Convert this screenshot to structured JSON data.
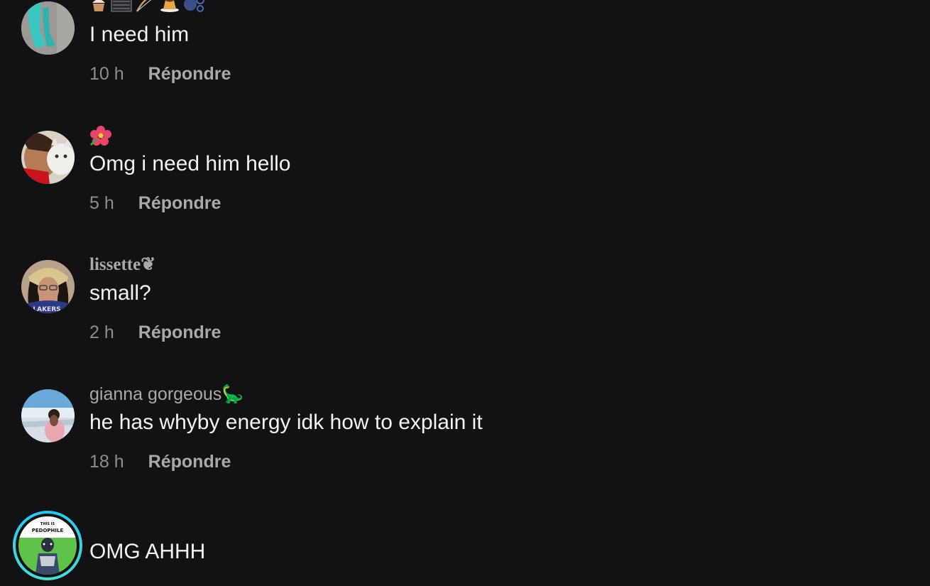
{
  "reply_label": "Répondre",
  "colors": {
    "background": "#121214",
    "text": "#f2f2f2",
    "muted": "#8d8d92",
    "reply": "#a9a9ad",
    "story_ring": "#29c4f0"
  },
  "comments": [
    {
      "username_icons": [
        "cupcake-icon",
        "music-sheet-icon",
        "bow-icon",
        "pudding-icon",
        "bubbles-icon"
      ],
      "text": "I need him",
      "time": "10 h"
    },
    {
      "username_icons": [
        "hibiscus-icon"
      ],
      "text": "Omg i need him hello",
      "time": "5 h"
    },
    {
      "username": "lissette❦",
      "text": "small?",
      "time": "2 h"
    },
    {
      "username": "gianna gorgeous🦕",
      "text": "he has whyby energy idk how to explain it",
      "time": "18 h"
    },
    {
      "text": "OMG AHHH",
      "avatar_caption_line1": "THIS IS",
      "avatar_caption_line2": "PEDOPHILE"
    }
  ]
}
